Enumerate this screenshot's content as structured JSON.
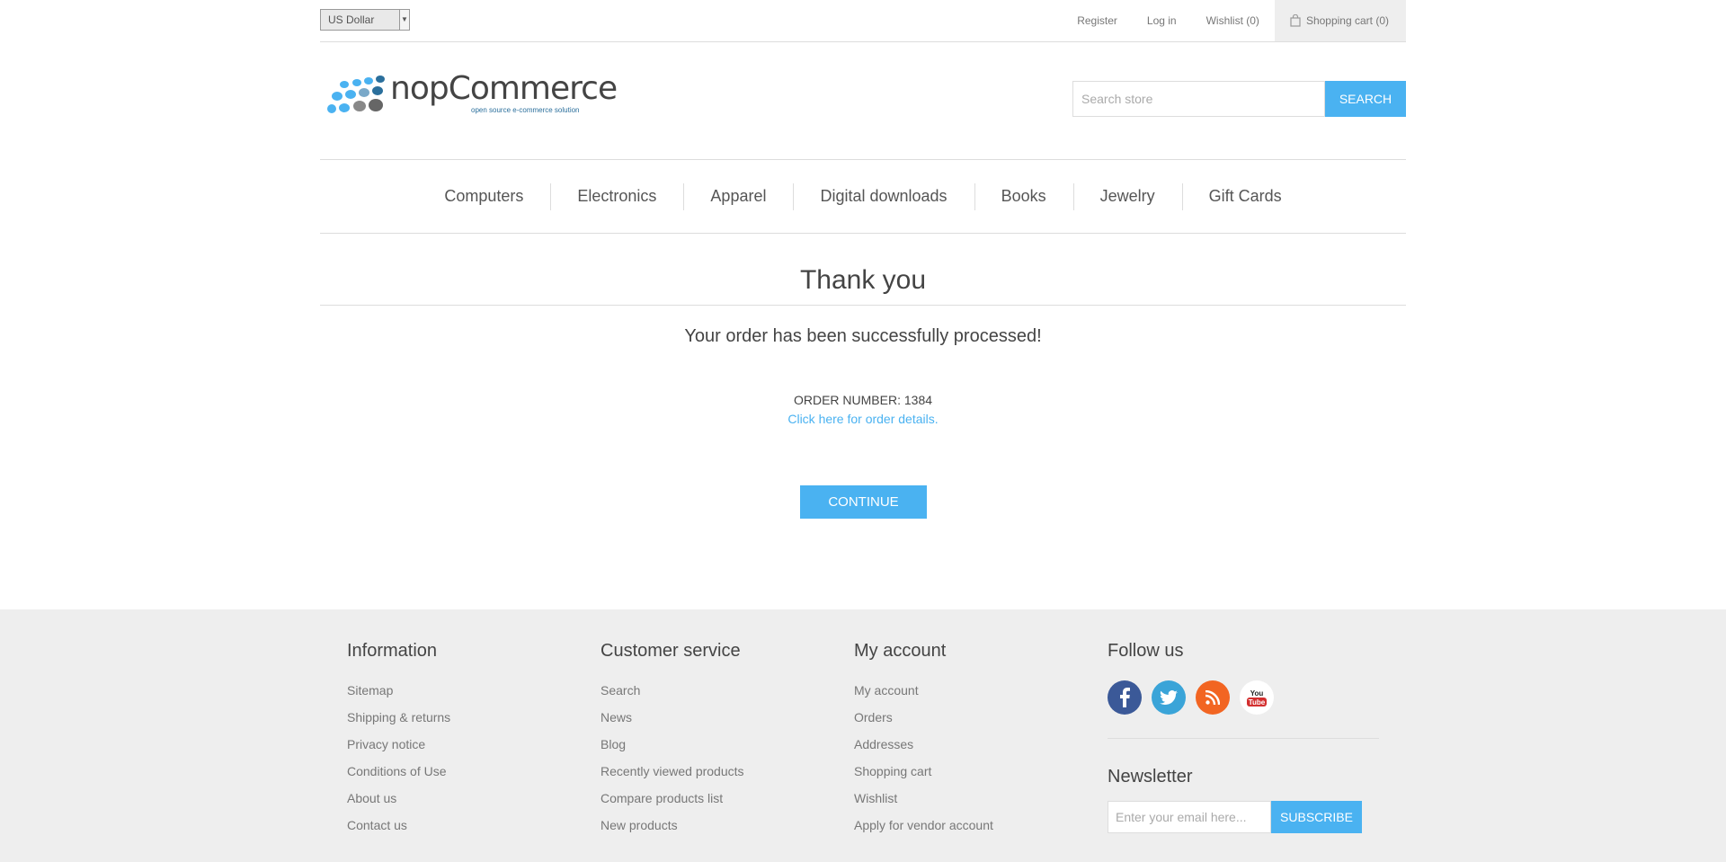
{
  "header": {
    "currency": "US Dollar",
    "links": {
      "register": "Register",
      "login": "Log in",
      "wishlist": "Wishlist (0)",
      "cart": "Shopping cart (0)"
    },
    "logo": {
      "name": "nopCommerce",
      "tagline": "open source e-commerce solution"
    },
    "search": {
      "placeholder": "Search store",
      "button": "Search"
    }
  },
  "menu": [
    "Computers",
    "Electronics",
    "Apparel",
    "Digital downloads",
    "Books",
    "Jewelry",
    "Gift Cards"
  ],
  "page": {
    "title": "Thank you",
    "message": "Your order has been successfully processed!",
    "order_number": "Order number: 1384",
    "order_link": "Click here for order details.",
    "continue": "Continue"
  },
  "footer": {
    "information": {
      "title": "Information",
      "items": [
        "Sitemap",
        "Shipping & returns",
        "Privacy notice",
        "Conditions of Use",
        "About us",
        "Contact us"
      ]
    },
    "customer_service": {
      "title": "Customer service",
      "items": [
        "Search",
        "News",
        "Blog",
        "Recently viewed products",
        "Compare products list",
        "New products"
      ]
    },
    "my_account": {
      "title": "My account",
      "items": [
        "My account",
        "Orders",
        "Addresses",
        "Shopping cart",
        "Wishlist",
        "Apply for vendor account"
      ]
    },
    "follow_us": {
      "title": "Follow us",
      "icons": [
        "facebook-icon",
        "twitter-icon",
        "rss-icon",
        "youtube-icon"
      ]
    },
    "newsletter": {
      "title": "Newsletter",
      "placeholder": "Enter your email here...",
      "button": "Subscribe"
    }
  },
  "colors": {
    "accent": "#4ab2f1",
    "footer_bg": "#eeeeee",
    "facebook": "#3b5998",
    "twitter": "#3aa4d8",
    "rss": "#f26522"
  }
}
